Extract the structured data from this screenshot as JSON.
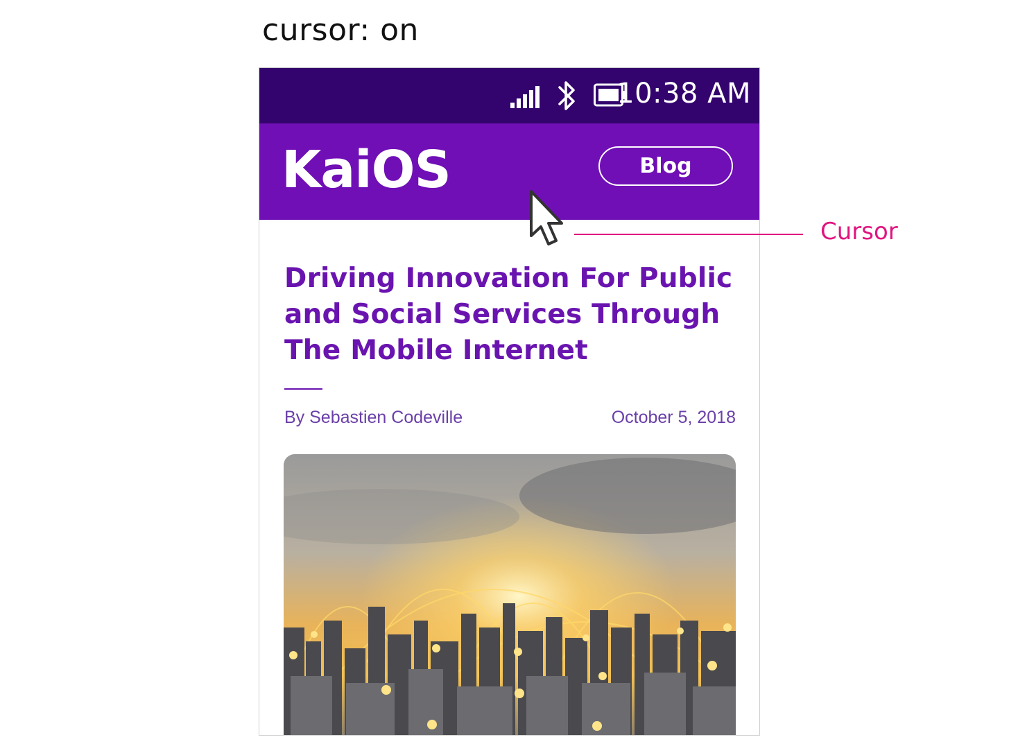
{
  "caption": "cursor: on",
  "status_bar": {
    "time": "10:38 AM",
    "icons": [
      "signal-icon",
      "bluetooth-icon",
      "battery-icon"
    ],
    "background": "#33046d"
  },
  "header": {
    "logo_text": "KaiOS",
    "button_label": "Blog",
    "background": "#6f0fb5"
  },
  "article": {
    "title": "Driving Innovation For Public and Social Services Through The Mobile Internet",
    "author": "By Sebastien Codeville",
    "date": "October 5, 2018",
    "accent_color": "#6a14b0"
  },
  "annotation": {
    "label": "Cursor",
    "color": "#e0157f"
  }
}
